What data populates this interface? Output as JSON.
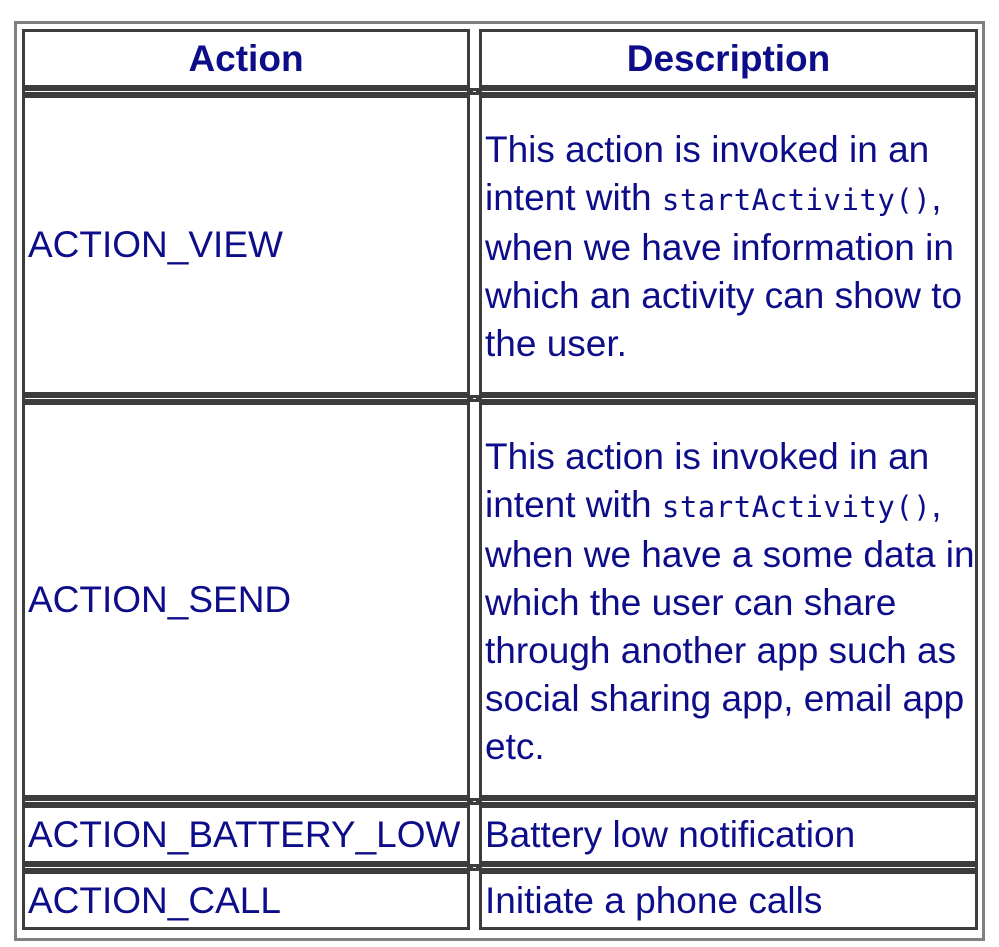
{
  "table": {
    "headers": {
      "action": "Action",
      "description": "Description"
    },
    "rows": [
      {
        "action": "ACTION_VIEW",
        "desc_pre": "This action is invoked in an intent with",
        "desc_code": "startActivity()",
        "desc_post": ", when we have information in which an activity can show to the user."
      },
      {
        "action": "ACTION_SEND",
        "desc_pre": "This action is invoked in an intent with",
        "desc_code": "startActivity()",
        "desc_post": ", when we have a some data in which the user can share through another app such as social sharing app, email app etc."
      },
      {
        "action": "ACTION_BATTERY_LOW",
        "desc_pre": "Battery low notification",
        "desc_code": "",
        "desc_post": ""
      },
      {
        "action": "ACTION_CALL",
        "desc_pre": "Initiate a phone calls",
        "desc_code": "",
        "desc_post": ""
      }
    ]
  }
}
